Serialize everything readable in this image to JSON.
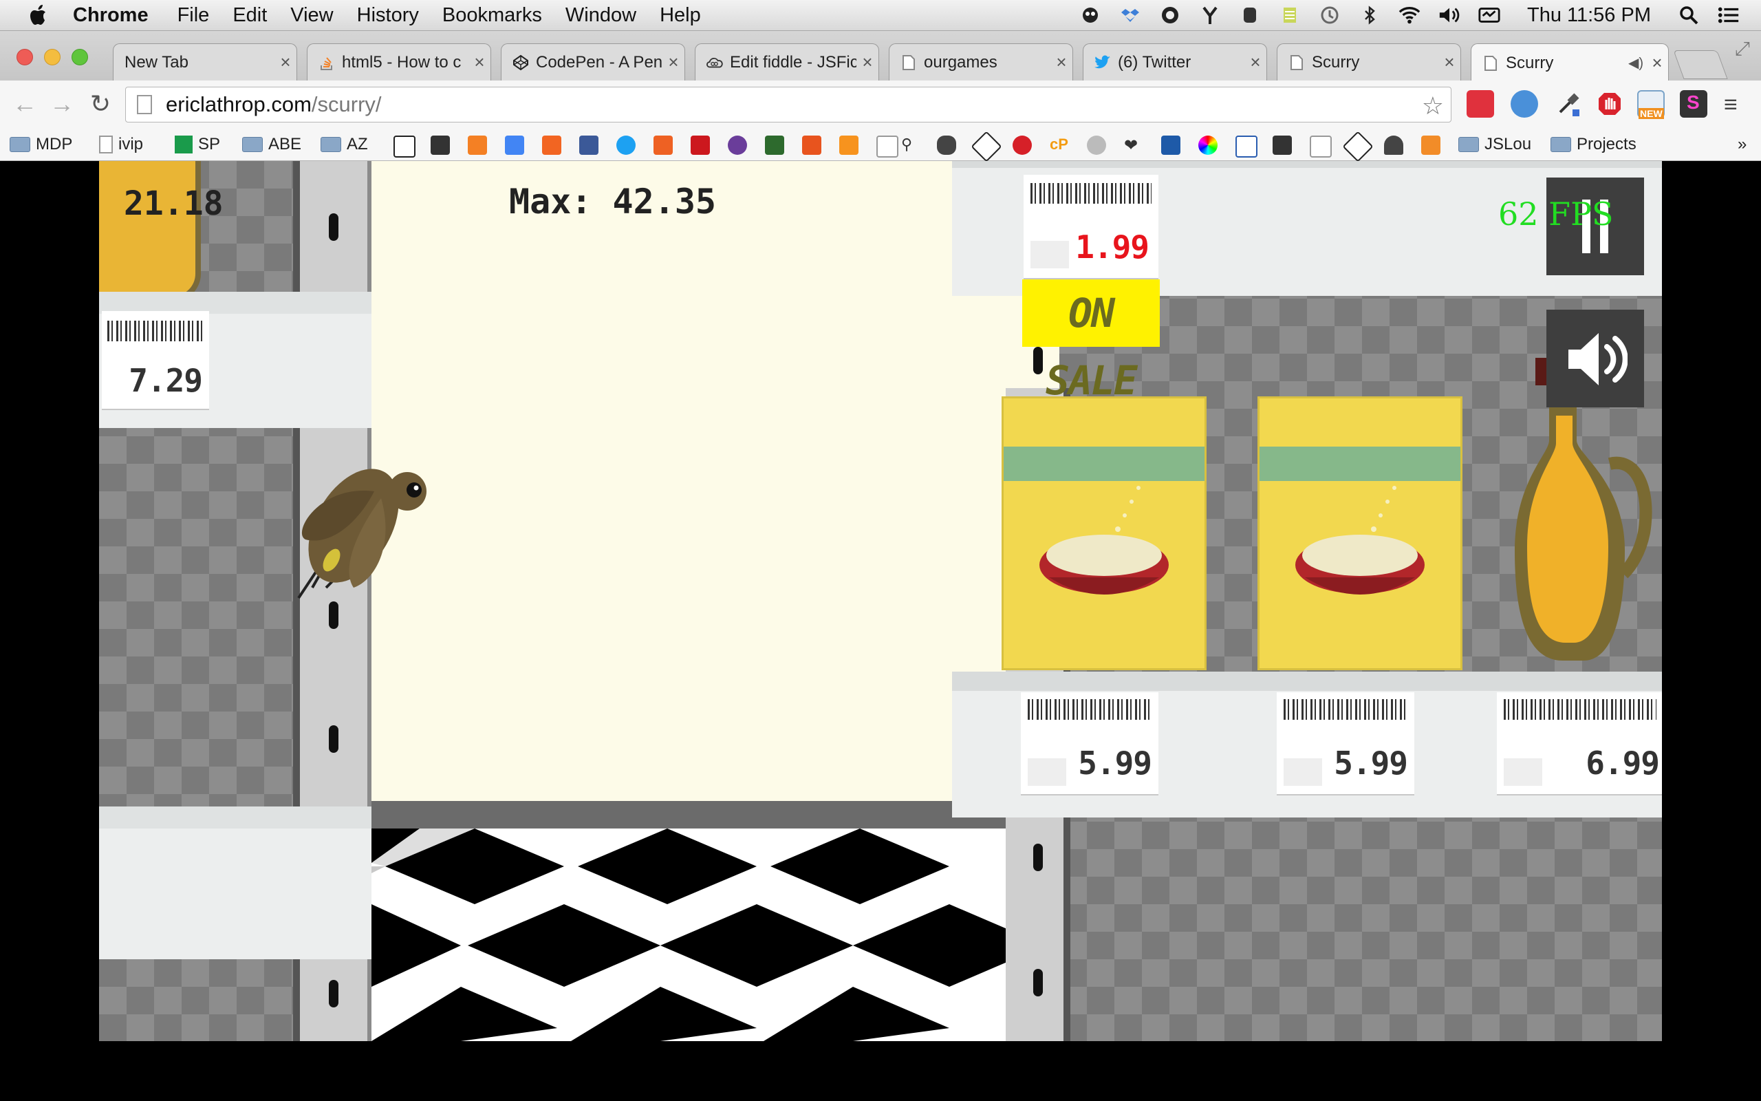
{
  "menubar": {
    "app_name": "Chrome",
    "menus": [
      "File",
      "Edit",
      "View",
      "History",
      "Bookmarks",
      "Window",
      "Help"
    ],
    "clock": "Thu 11:56 PM"
  },
  "tabs": [
    {
      "title": "New Tab"
    },
    {
      "title": "html5 - How to c"
    },
    {
      "title": "CodePen - A Pen"
    },
    {
      "title": "Edit fiddle - JSFic"
    },
    {
      "title": "ourgames"
    },
    {
      "title": "(6) Twitter"
    },
    {
      "title": "Scurry"
    },
    {
      "title": "Scurry"
    }
  ],
  "toolbar": {
    "url_host": "ericlathrop.com",
    "url_path": "/scurry/"
  },
  "bookmarks": {
    "mdp": "MDP",
    "ivip": "ivip",
    "sp": "SP",
    "abe": "ABE",
    "az": "AZ",
    "jslou": "JSLou",
    "projects": "Projects",
    "overflow": "»"
  },
  "game": {
    "score": "21.18",
    "max_label": "Max: 42.35",
    "fps": "62 FPS",
    "on_sale": "ON SALE",
    "prices": {
      "left_shelf": "7.29",
      "sale": "1.99",
      "box1": "5.99",
      "box2": "5.99",
      "bottle": "6.99"
    }
  }
}
